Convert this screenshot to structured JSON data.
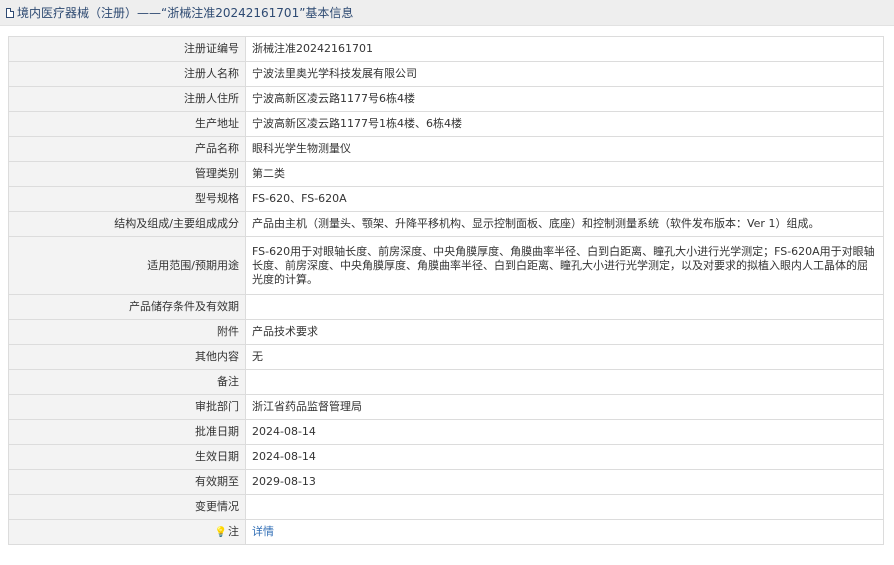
{
  "header": {
    "title": "境内医疗器械（注册）——“浙械注准20242161701”基本信息"
  },
  "rows": [
    {
      "label": "注册证编号",
      "value": "浙械注准20242161701"
    },
    {
      "label": "注册人名称",
      "value": "宁波法里奥光学科技发展有限公司"
    },
    {
      "label": "注册人住所",
      "value": "宁波高新区凌云路1177号6栋4楼"
    },
    {
      "label": "生产地址",
      "value": "宁波高新区凌云路1177号1栋4楼、6栋4楼"
    },
    {
      "label": "产品名称",
      "value": "眼科光学生物测量仪"
    },
    {
      "label": "管理类别",
      "value": "第二类"
    },
    {
      "label": "型号规格",
      "value": "FS-620、FS-620A"
    },
    {
      "label": "结构及组成/主要组成成分",
      "value": "产品由主机（测量头、颚架、升降平移机构、显示控制面板、底座）和控制测量系统（软件发布版本：Ver 1）组成。"
    },
    {
      "label": "适用范围/预期用途",
      "value": "FS-620用于对眼轴长度、前房深度、中央角膜厚度、角膜曲率半径、白到白距离、瞳孔大小进行光学测定；FS-620A用于对眼轴长度、前房深度、中央角膜厚度、角膜曲率半径、白到白距离、瞳孔大小进行光学测定，以及对要求的拟植入眼内人工晶体的屈光度的计算。"
    },
    {
      "label": "产品储存条件及有效期",
      "value": ""
    },
    {
      "label": "附件",
      "value": "产品技术要求"
    },
    {
      "label": "其他内容",
      "value": "无"
    },
    {
      "label": "备注",
      "value": ""
    },
    {
      "label": "审批部门",
      "value": "浙江省药品监督管理局"
    },
    {
      "label": "批准日期",
      "value": "2024-08-14"
    },
    {
      "label": "生效日期",
      "value": "2024-08-14"
    },
    {
      "label": "有效期至",
      "value": "2029-08-13"
    },
    {
      "label": "变更情况",
      "value": ""
    }
  ],
  "note": {
    "label": "注",
    "icon": "lightbulb-icon",
    "link_text": "详情"
  }
}
